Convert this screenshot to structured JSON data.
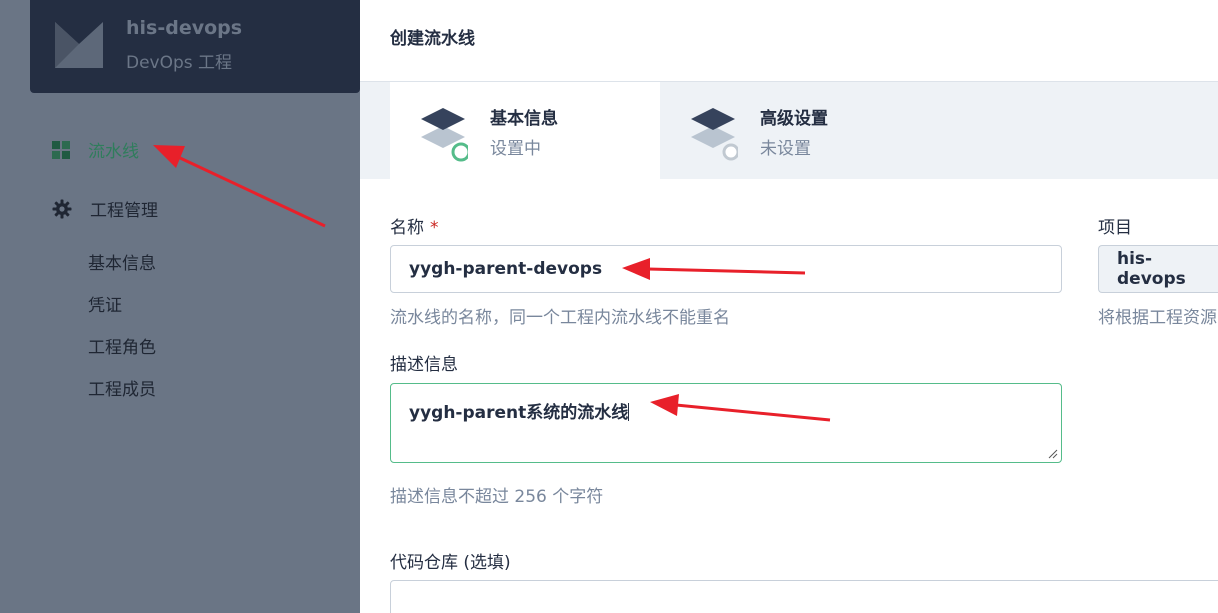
{
  "sidebar": {
    "project_name": "his-devops",
    "project_type": "DevOps 工程",
    "nav": {
      "pipeline": "流水线",
      "project_management": "工程管理"
    },
    "sub_items": [
      "基本信息",
      "凭证",
      "工程角色",
      "工程成员"
    ]
  },
  "header": {
    "title": "创建流水线"
  },
  "steps": [
    {
      "title": "基本信息",
      "status": "设置中"
    },
    {
      "title": "高级设置",
      "status": "未设置"
    }
  ],
  "form": {
    "name_label": "名称",
    "required_mark": "*",
    "name_value": "yygh-parent-devops",
    "name_hint": "流水线的名称，同一个工程内流水线不能重名",
    "project_label": "项目",
    "project_value": "his-devops",
    "project_hint": "将根据工程资源",
    "desc_label": "描述信息",
    "desc_value": "yygh-parent系统的流水线",
    "desc_hint": "描述信息不超过 256 个字符",
    "repo_label": "代码仓库 (选填)"
  },
  "colors": {
    "accent": "#55bc8a",
    "annotation_arrow": "#e8202a"
  }
}
